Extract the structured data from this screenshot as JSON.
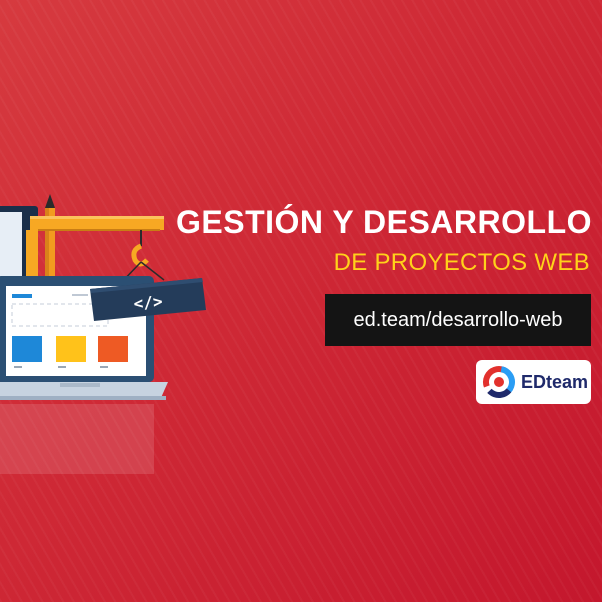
{
  "banner": {
    "title_line1": "GESTIÓN Y DESARROLLO",
    "title_line2": "DE PROYECTOS WEB",
    "url": "ed.team/desarrollo-web",
    "brand_name": "EDteam",
    "code_sign": "</>"
  },
  "colors": {
    "background": "#cf2a36",
    "title_primary": "#ffffff",
    "title_accent": "#ffd21a",
    "url_box": "#141414",
    "crane": "#f7a823",
    "laptop_screen": "#1e88d8",
    "brand_blue": "#1f2a6b"
  },
  "icons": [
    "laptop-illustration",
    "crane-illustration",
    "pencil-icon",
    "code-sign-icon",
    "edteam-logo-icon"
  ]
}
